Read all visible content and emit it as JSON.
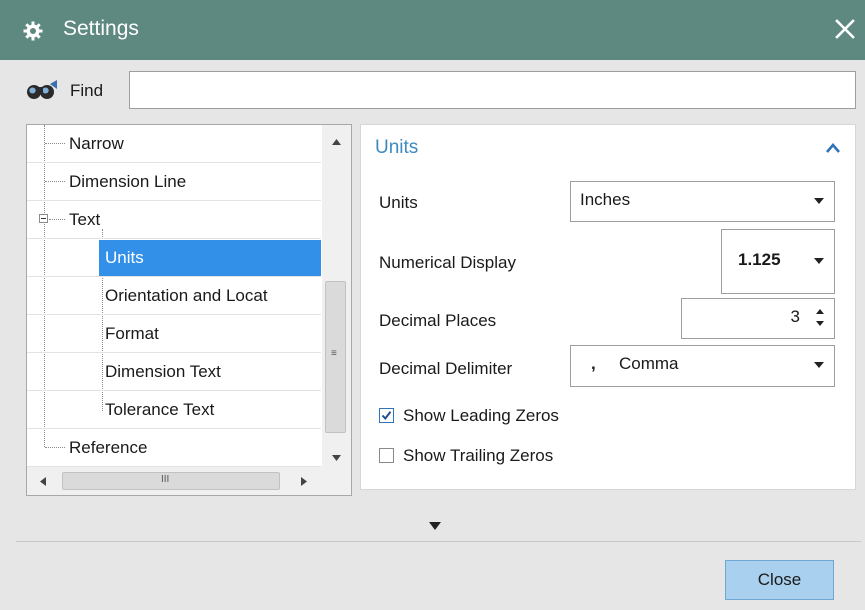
{
  "window": {
    "title": "Settings",
    "title_bar_color": "#5e8981"
  },
  "find": {
    "label": "Find",
    "value": ""
  },
  "tree": {
    "items": [
      {
        "label": "Narrow"
      },
      {
        "label": "Dimension Line"
      },
      {
        "label": "Text"
      },
      {
        "label": "Units"
      },
      {
        "label": "Orientation and Locat"
      },
      {
        "label": "Format"
      },
      {
        "label": "Dimension Text"
      },
      {
        "label": "Tolerance Text"
      },
      {
        "label": "Reference"
      }
    ],
    "selected": "Units",
    "hscroll_grip": "III",
    "vscroll_grip": "≡"
  },
  "panel": {
    "section_title": "Units",
    "fields": {
      "units": {
        "label": "Units",
        "value": "Inches"
      },
      "numerical_display": {
        "label": "Numerical Display",
        "value": "1.125"
      },
      "decimal_places": {
        "label": "Decimal Places",
        "value": "3"
      },
      "decimal_delimiter": {
        "label": "Decimal Delimiter",
        "symbol": ",",
        "value": "Comma"
      }
    },
    "checkboxes": {
      "show_leading_zeros": {
        "label": "Show Leading Zeros",
        "checked": true
      },
      "show_trailing_zeros": {
        "label": "Show Trailing Zeros",
        "checked": false
      }
    }
  },
  "footer": {
    "close_label": "Close"
  },
  "colors": {
    "accent": "#3d8bbf",
    "selection": "#3390e8",
    "button": "#a9d0ee"
  }
}
